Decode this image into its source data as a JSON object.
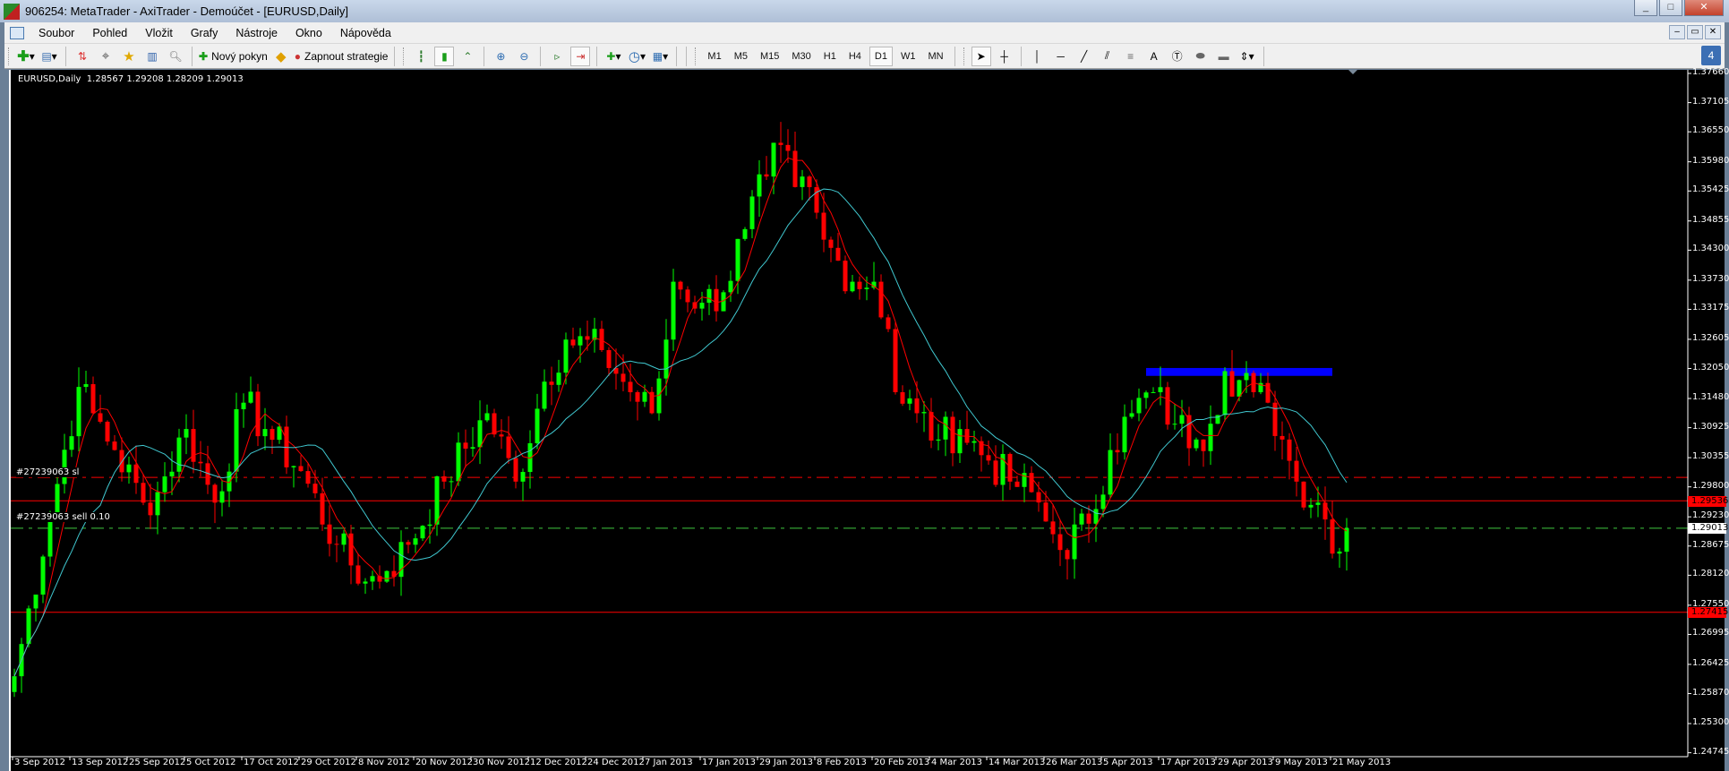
{
  "window": {
    "title": "906254: MetaTrader - AxiTrader - Demoúčet - [EURUSD,Daily]",
    "min": "_",
    "max": "□",
    "close": "✕"
  },
  "menu": [
    "Soubor",
    "Pohled",
    "Vložit",
    "Grafy",
    "Nástroje",
    "Okno",
    "Nápověda"
  ],
  "toolbar": {
    "new_order": "Nový pokyn",
    "strategies": "Zapnout strategie",
    "timeframes": [
      "M1",
      "M5",
      "M15",
      "M30",
      "H1",
      "H4",
      "D1",
      "W1",
      "MN"
    ],
    "active_timeframe": "D1",
    "text_tool": "A",
    "notifications": "4"
  },
  "chart": {
    "header": "EURUSD,Daily  1.28567 1.29208 1.28209 1.29013",
    "price_labels": [
      "1.37660",
      "1.37105",
      "1.36550",
      "1.35980",
      "1.35425",
      "1.34855",
      "1.34300",
      "1.33730",
      "1.33175",
      "1.32605",
      "1.32050",
      "1.31480",
      "1.30925",
      "1.30355",
      "1.29800",
      "1.29230",
      "1.28675",
      "1.28120",
      "1.27550",
      "1.26995",
      "1.26425",
      "1.25870",
      "1.25300",
      "1.24745"
    ],
    "date_labels": [
      "3 Sep 2012",
      "13 Sep 2012",
      "25 Sep 2012",
      "5 Oct 2012",
      "17 Oct 2012",
      "29 Oct 2012",
      "8 Nov 2012",
      "20 Nov 2012",
      "30 Nov 2012",
      "12 Dec 2012",
      "24 Dec 2012",
      "7 Jan 2013",
      "17 Jan 2013",
      "29 Jan 2013",
      "8 Feb 2013",
      "20 Feb 2013",
      "4 Mar 2013",
      "14 Mar 2013",
      "26 Mar 2013",
      "5 Apr 2013",
      "17 Apr 2013",
      "29 Apr 2013",
      "9 May 2013",
      "21 May 2013"
    ],
    "lines": {
      "sl": {
        "label": "#27239063 sl",
        "price": 1.2998
      },
      "order": {
        "label": "#27239063 sell 0.10",
        "price": 1.29013,
        "tag": "1.29013"
      },
      "level1": {
        "price": 1.29536,
        "tag": "1.29536"
      },
      "level2": {
        "price": 1.27415,
        "tag": "1.27415"
      }
    },
    "zone": {
      "from_bar": 158,
      "to_bar": 184,
      "top": 1.3206,
      "bottom": 1.3191,
      "color": "#0000ff"
    },
    "colors": {
      "bull": "#00ff00",
      "bear": "#ff0000",
      "ma_fast": "#ff0000",
      "ma_slow": "#40c8d0"
    }
  },
  "chart_data": {
    "type": "candlestick",
    "symbol": "EURUSD",
    "timeframe": "Daily",
    "ylim": [
      1.24745,
      1.3766
    ],
    "bars": 187,
    "last_ohlc": [
      1.28567,
      1.29208,
      1.28209,
      1.29013
    ],
    "close_keypoints": [
      [
        0,
        1.262
      ],
      [
        5,
        1.293
      ],
      [
        9,
        1.317
      ],
      [
        11,
        1.312
      ],
      [
        14,
        1.305
      ],
      [
        18,
        1.295
      ],
      [
        20,
        1.297
      ],
      [
        24,
        1.309
      ],
      [
        28,
        1.295
      ],
      [
        32,
        1.314
      ],
      [
        35,
        1.309
      ],
      [
        40,
        1.301
      ],
      [
        45,
        1.287
      ],
      [
        49,
        1.28
      ],
      [
        52,
        1.282
      ],
      [
        55,
        1.287
      ],
      [
        60,
        1.299
      ],
      [
        66,
        1.312
      ],
      [
        70,
        1.299
      ],
      [
        74,
        1.318
      ],
      [
        77,
        1.326
      ],
      [
        82,
        1.324
      ],
      [
        86,
        1.316
      ],
      [
        89,
        1.312
      ],
      [
        91,
        1.326
      ],
      [
        92,
        1.337
      ],
      [
        96,
        1.333
      ],
      [
        99,
        1.335
      ],
      [
        102,
        1.347
      ],
      [
        105,
        1.357
      ],
      [
        107,
        1.363
      ],
      [
        109,
        1.355
      ],
      [
        110,
        1.357
      ],
      [
        113,
        1.345
      ],
      [
        115,
        1.341
      ],
      [
        117,
        1.337
      ],
      [
        120,
        1.337
      ],
      [
        122,
        1.328
      ],
      [
        123,
        1.316
      ],
      [
        126,
        1.312
      ],
      [
        129,
        1.307
      ],
      [
        132,
        1.309
      ],
      [
        136,
        1.303
      ],
      [
        139,
        1.299
      ],
      [
        142,
        1.297
      ],
      [
        145,
        1.289
      ],
      [
        146,
        1.286
      ],
      [
        150,
        1.291
      ],
      [
        153,
        1.305
      ],
      [
        156,
        1.312
      ],
      [
        159,
        1.316
      ],
      [
        162,
        1.31
      ],
      [
        165,
        1.307
      ],
      [
        167,
        1.31
      ],
      [
        169,
        1.32
      ],
      [
        173,
        1.316
      ],
      [
        175,
        1.314
      ],
      [
        177,
        1.307
      ],
      [
        179,
        1.299
      ],
      [
        182,
        1.295
      ],
      [
        185,
        1.2857
      ],
      [
        186,
        1.29013
      ]
    ]
  }
}
